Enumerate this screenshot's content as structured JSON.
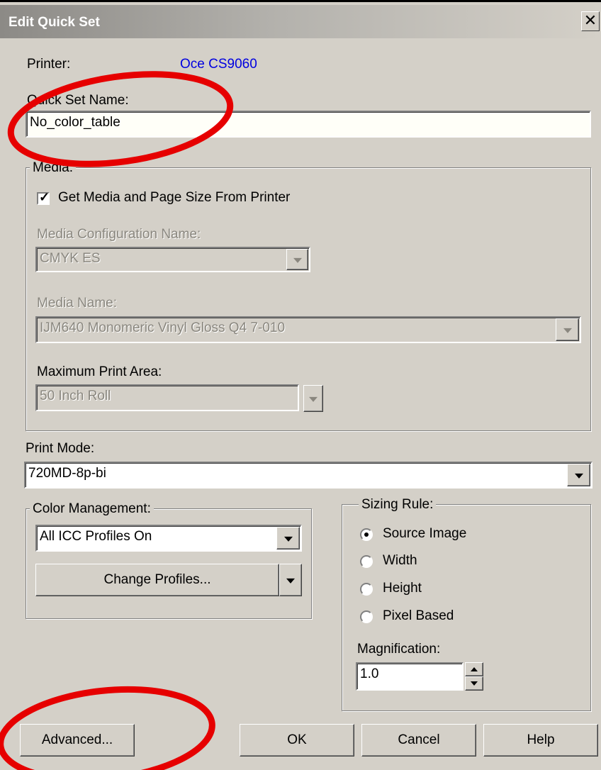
{
  "window": {
    "title": "Edit Quick Set",
    "close_glyph": "✕"
  },
  "printer": {
    "label": "Printer:",
    "value": "Oce CS9060"
  },
  "quick_set": {
    "label": "Quick Set Name:",
    "value": "No_color_table"
  },
  "media": {
    "legend": "Media:",
    "get_from_printer": {
      "label": "Get Media and Page Size From Printer",
      "checked": true
    },
    "config": {
      "label": "Media Configuration Name:",
      "value": "CMYK ES"
    },
    "name": {
      "label": "Media Name:",
      "value": "IJM640 Monomeric Vinyl Gloss Q4 7-010"
    },
    "area": {
      "label": "Maximum Print Area:",
      "value": "50 Inch Roll"
    }
  },
  "print_mode": {
    "label": "Print Mode:",
    "value": "720MD-8p-bi"
  },
  "color_management": {
    "legend": "Color Management:",
    "value": "All ICC Profiles On",
    "change_button": "Change Profiles..."
  },
  "sizing_rule": {
    "legend": "Sizing Rule:",
    "options": [
      {
        "label": "Source Image",
        "selected": true
      },
      {
        "label": "Width",
        "selected": false
      },
      {
        "label": "Height",
        "selected": false
      },
      {
        "label": "Pixel Based",
        "selected": false
      }
    ],
    "magnification": {
      "label": "Magnification:",
      "value": "1.0"
    }
  },
  "buttons": {
    "advanced": "Advanced...",
    "ok": "OK",
    "cancel": "Cancel",
    "help": "Help"
  },
  "annotation_color": "#e60000"
}
